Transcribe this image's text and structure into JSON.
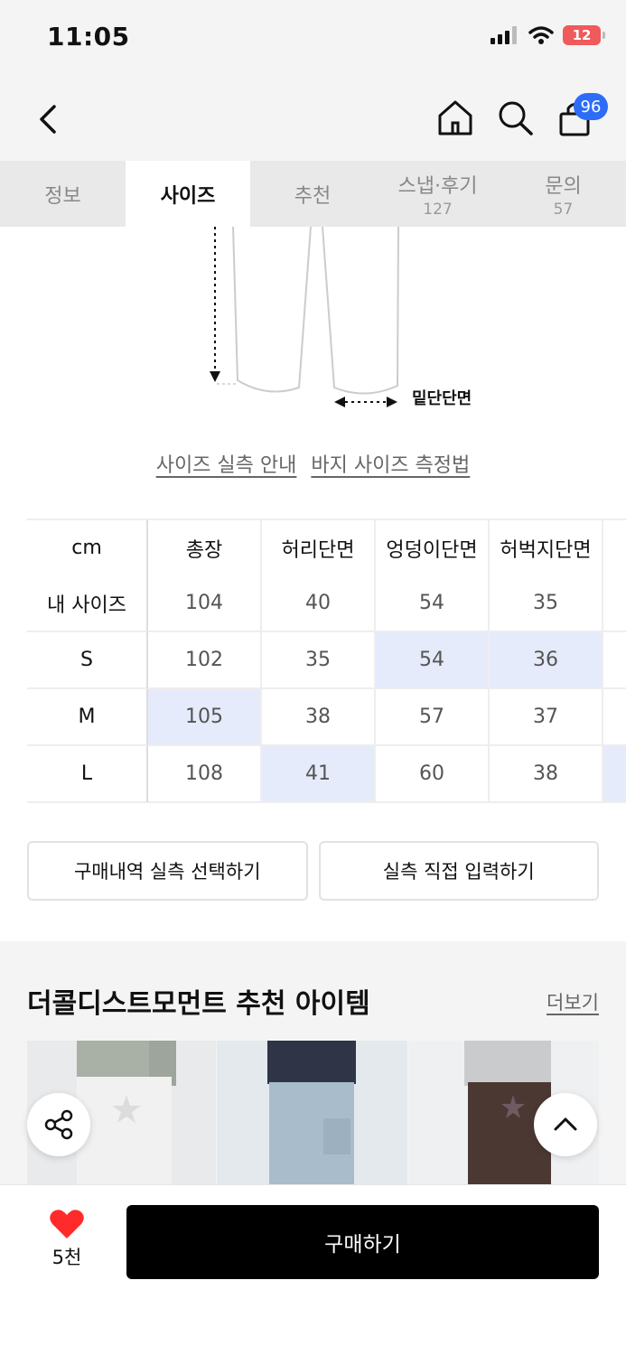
{
  "status_bar": {
    "time": "11:05",
    "battery": "12"
  },
  "header": {
    "cart_count": "96"
  },
  "tabs": [
    {
      "label": "정보",
      "count": ""
    },
    {
      "label": "사이즈",
      "count": ""
    },
    {
      "label": "추천",
      "count": ""
    },
    {
      "label": "스냅·후기",
      "count": "127"
    },
    {
      "label": "문의",
      "count": "57"
    }
  ],
  "active_tab": "사이즈",
  "diagram": {
    "label": "밑단단면"
  },
  "guide_links": {
    "actual_size": "사이즈 실측 안내",
    "measure_method": "바지 사이즈 측정법"
  },
  "size_table": {
    "headers": [
      "cm",
      "총장",
      "허리단면",
      "엉덩이단면",
      "허벅지단면"
    ],
    "rows": [
      {
        "label": "내 사이즈",
        "values": [
          "104",
          "40",
          "54",
          "35"
        ]
      },
      {
        "label": "S",
        "values": [
          "102",
          "35",
          "54",
          "36"
        ]
      },
      {
        "label": "M",
        "values": [
          "105",
          "38",
          "57",
          "37"
        ]
      },
      {
        "label": "L",
        "values": [
          "108",
          "41",
          "60",
          "38"
        ]
      }
    ]
  },
  "actions": {
    "purchase_history": "구매내역 실측 선택하기",
    "direct_input": "실측 직접 입력하기"
  },
  "recommend": {
    "title": "더콜디스트모먼트 추천 아이템",
    "more": "더보기"
  },
  "bottom": {
    "like_count": "5천",
    "buy": "구매하기"
  },
  "colors": {
    "accent": "#2d6cf6",
    "highlight": "#e6ebfb",
    "heart": "#ff2a2a",
    "buy": "#000000"
  }
}
